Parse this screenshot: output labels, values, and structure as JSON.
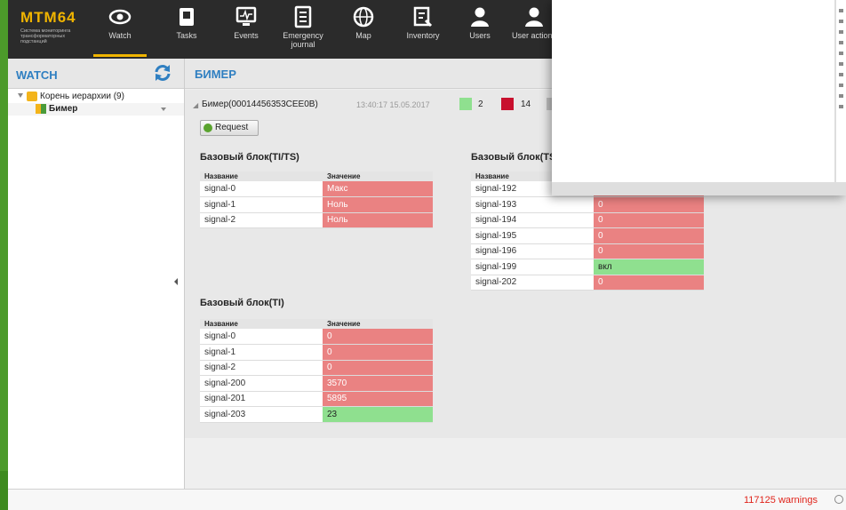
{
  "app": {
    "logo_text": "MTM64",
    "logo_subtitle": "Система мониторинга трансформаторных подстанций"
  },
  "nav": [
    {
      "label": "Watch",
      "icon": "eye-icon"
    },
    {
      "label": "Tasks",
      "icon": "tasks-icon"
    },
    {
      "label": "Events",
      "icon": "events-monitor-icon"
    },
    {
      "label": "Emergency journal",
      "icon": "journal-icon"
    },
    {
      "label": "Map",
      "icon": "globe-icon"
    },
    {
      "label": "Inventory",
      "icon": "inventory-icon"
    },
    {
      "label": "Users",
      "icon": "user-icon"
    },
    {
      "label": "User actions",
      "icon": "user-actions-icon"
    }
  ],
  "sidebar": {
    "title": "WATCH",
    "tree": [
      {
        "label": "Корень иерархии (9)",
        "icon": "folder-icon"
      },
      {
        "label": "Бимер",
        "icon": "device-icon"
      }
    ]
  },
  "main": {
    "title": "БИМЕР",
    "device": {
      "name": "Бимер(00014456353CEE0B)",
      "timestamp": "13:40:17 15.05.2017",
      "counts": [
        {
          "color": "#8fe08f",
          "value": "2"
        },
        {
          "color": "#c8102e",
          "value": "14"
        },
        {
          "color": "#c0c0c0",
          "value": ""
        }
      ]
    },
    "request_label": "Request",
    "blocks": [
      {
        "title": "Базовый блок(TI/TS)",
        "col_name": "Название",
        "col_value": "Значение",
        "rows": [
          {
            "name": "signal-0",
            "value": "Макс",
            "status": "red"
          },
          {
            "name": "signal-1",
            "value": "Ноль",
            "status": "red"
          },
          {
            "name": "signal-2",
            "value": "Ноль",
            "status": "red"
          }
        ]
      },
      {
        "title": "Базовый блок(TS",
        "col_name": "Название",
        "col_value": "",
        "rows": [
          {
            "name": "signal-192",
            "value": "",
            "status": "red"
          },
          {
            "name": "signal-193",
            "value": "0",
            "status": "red"
          },
          {
            "name": "signal-194",
            "value": "0",
            "status": "red"
          },
          {
            "name": "signal-195",
            "value": "0",
            "status": "red"
          },
          {
            "name": "signal-196",
            "value": "0",
            "status": "red"
          },
          {
            "name": "signal-199",
            "value": "вкл",
            "status": "green"
          },
          {
            "name": "signal-202",
            "value": "0",
            "status": "red"
          }
        ]
      },
      {
        "title": "Базовый блок(TI)",
        "col_name": "Название",
        "col_value": "Значение",
        "rows": [
          {
            "name": "signal-0",
            "value": "0",
            "status": "red"
          },
          {
            "name": "signal-1",
            "value": "0",
            "status": "red"
          },
          {
            "name": "signal-2",
            "value": "0",
            "status": "red"
          },
          {
            "name": "signal-200",
            "value": "3570",
            "status": "red"
          },
          {
            "name": "signal-201",
            "value": "5895",
            "status": "red"
          },
          {
            "name": "signal-203",
            "value": "23",
            "status": "green"
          }
        ]
      }
    ]
  },
  "status": {
    "warnings": "117125 warnings"
  },
  "colors": {
    "accent": "#2f7fc1",
    "red_value": "#ea8282",
    "green_value": "#8fe08f",
    "warning_text": "#e0241b"
  }
}
